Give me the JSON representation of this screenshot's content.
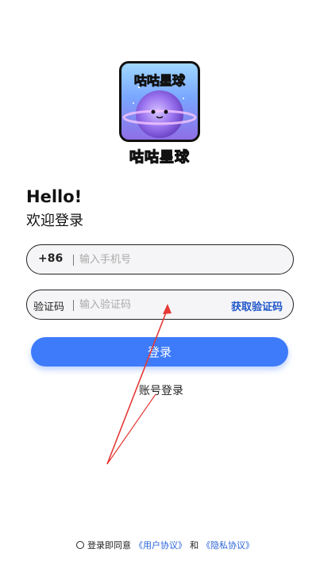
{
  "app": {
    "logo_text": "咕咕星球",
    "logo_icon": "planet-mascot-icon"
  },
  "greeting": {
    "hello": "Hello!",
    "welcome": "欢迎登录"
  },
  "phone_field": {
    "prefix": "+86",
    "placeholder": "输入手机号",
    "value": ""
  },
  "code_field": {
    "label": "验证码",
    "placeholder": "输入验证码",
    "value": "",
    "get_code": "获取验证码"
  },
  "buttons": {
    "login": "登录",
    "account_login": "账号登录"
  },
  "agreement": {
    "prefix": "登录即同意",
    "user_agreement": "《用户协议》",
    "and": "和",
    "privacy_policy": "《隐私协议》"
  },
  "colors": {
    "accent": "#3e7bfa",
    "link": "#2a64d8",
    "annotation": "#e53935"
  }
}
